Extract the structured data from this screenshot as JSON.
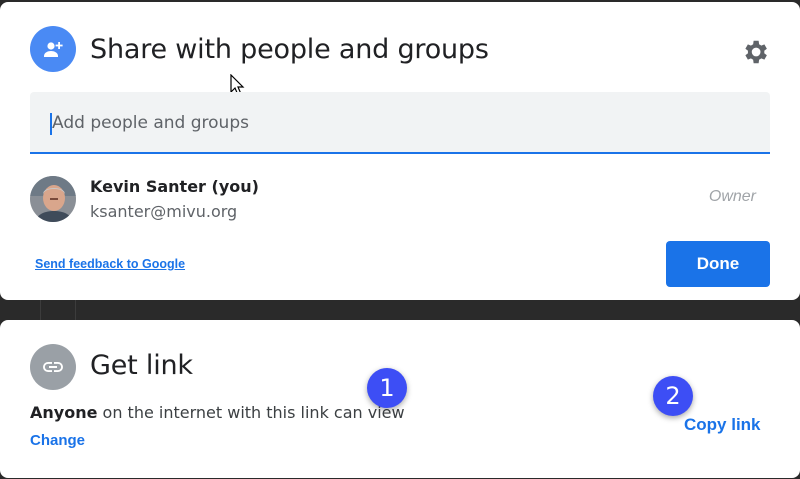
{
  "colors": {
    "accent": "#1a73e8",
    "share_icon_bg": "#4a8af4",
    "link_icon_bg": "#9aa0a6",
    "badge": "#3d4ef5"
  },
  "share_dialog": {
    "icon": "person-add-icon",
    "title": "Share with people and groups",
    "settings_icon": "gear-icon",
    "add_field": {
      "placeholder": "Add people and groups"
    },
    "person": {
      "name": "Kevin Santer (you)",
      "email": "ksanter@mivu.org",
      "role": "Owner",
      "avatar": "avatar-photo"
    },
    "feedback_link": "Send feedback to Google",
    "done_label": "Done"
  },
  "link_dialog": {
    "icon": "link-icon",
    "title": "Get link",
    "desc_bold": "Anyone",
    "desc_rest": " on the internet with this link can view",
    "change_label": "Change",
    "copy_label": "Copy link"
  },
  "badges": [
    "1",
    "2"
  ]
}
